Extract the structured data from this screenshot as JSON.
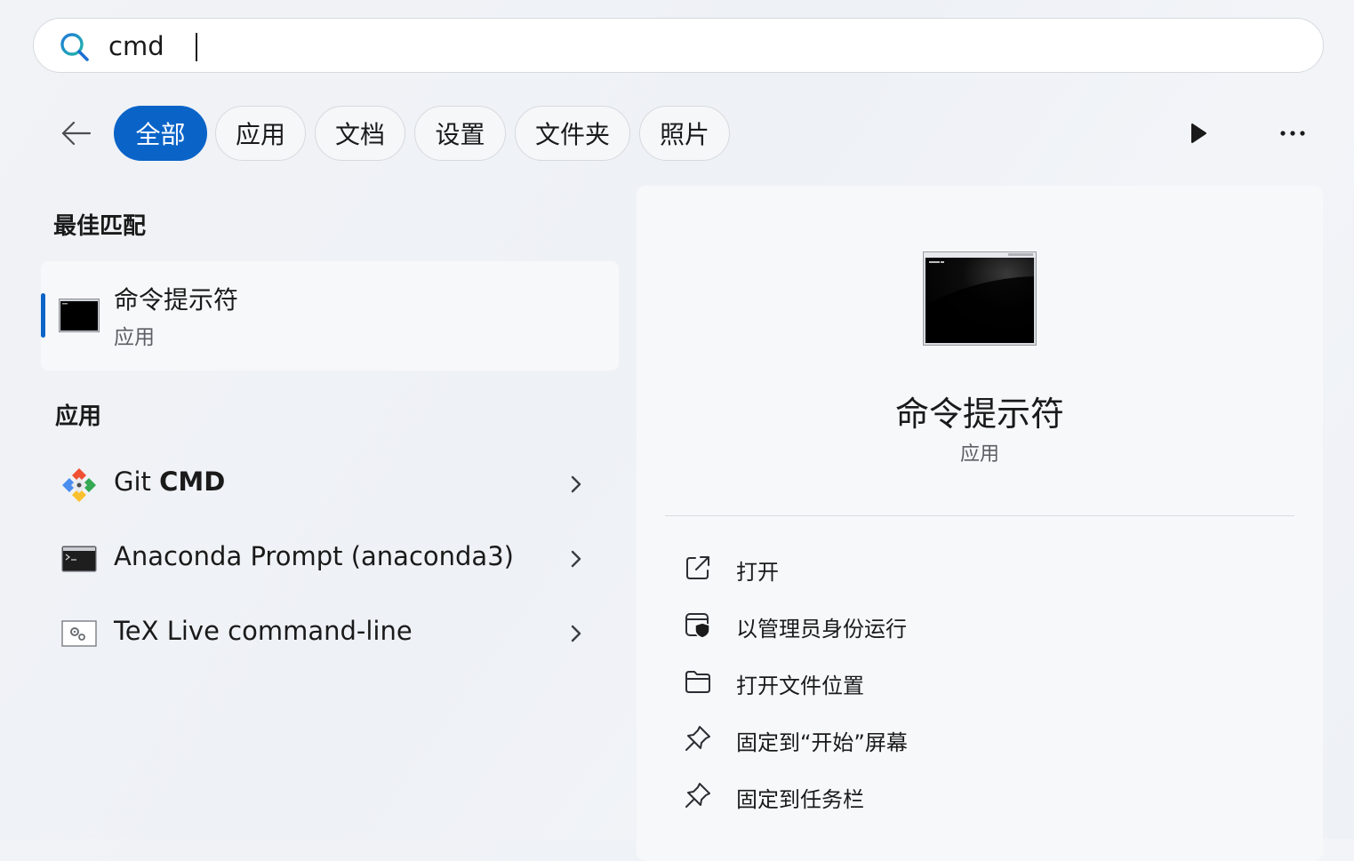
{
  "search": {
    "value": "cmd",
    "placeholder": ""
  },
  "filters": {
    "back_label": "back",
    "chips": [
      {
        "label": "全部",
        "active": true
      },
      {
        "label": "应用",
        "active": false
      },
      {
        "label": "文档",
        "active": false
      },
      {
        "label": "设置",
        "active": false
      },
      {
        "label": "文件夹",
        "active": false
      },
      {
        "label": "照片",
        "active": false
      }
    ]
  },
  "best_match": {
    "section_title": "最佳匹配",
    "title": "命令提示符",
    "subtitle": "应用",
    "icon": "command-prompt-icon"
  },
  "apps": {
    "section_title": "应用",
    "items": [
      {
        "name_prefix": "Git ",
        "name_bold": "CMD",
        "icon": "git-icon"
      },
      {
        "name": "Anaconda Prompt (anaconda3)",
        "icon": "anaconda-prompt-icon"
      },
      {
        "name": "TeX Live command-line",
        "icon": "tex-live-icon"
      }
    ]
  },
  "detail": {
    "title": "命令提示符",
    "subtitle": "应用",
    "actions": [
      {
        "label": "打开",
        "icon": "open-external-icon"
      },
      {
        "label": "以管理员身份运行",
        "icon": "admin-shield-icon"
      },
      {
        "label": "打开文件位置",
        "icon": "folder-icon"
      },
      {
        "label": "固定到“开始”屏幕",
        "icon": "pin-icon"
      },
      {
        "label": "固定到任务栏",
        "icon": "pin-icon"
      }
    ]
  },
  "colors": {
    "accent": "#0a64c8",
    "search_icon_gradient": [
      "#1f7ad8",
      "#22b8a8"
    ]
  }
}
